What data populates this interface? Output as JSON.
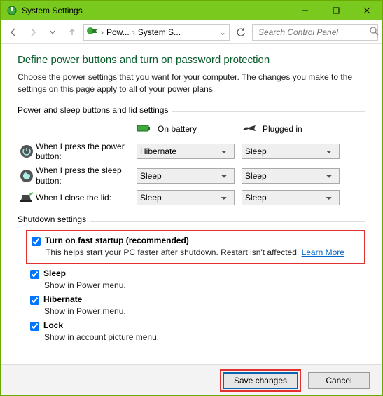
{
  "window": {
    "title": "System Settings"
  },
  "navbar": {
    "breadcrumb": {
      "item1": "Pow...",
      "item2": "System S..."
    },
    "search_placeholder": "Search Control Panel"
  },
  "page": {
    "title": "Define power buttons and turn on password protection",
    "description": "Choose the power settings that you want for your computer. The changes you make to the settings on this page apply to all of your power plans."
  },
  "buttons_section": {
    "label": "Power and sleep buttons and lid settings",
    "col_battery": "On battery",
    "col_plugged": "Plugged in",
    "rows": {
      "power_button": {
        "label": "When I press the power button:",
        "battery": "Hibernate",
        "plugged": "Sleep"
      },
      "sleep_button": {
        "label": "When I press the sleep button:",
        "battery": "Sleep",
        "plugged": "Sleep"
      },
      "lid": {
        "label": "When I close the lid:",
        "battery": "Sleep",
        "plugged": "Sleep"
      }
    }
  },
  "shutdown_section": {
    "label": "Shutdown settings",
    "fast_startup": {
      "label": "Turn on fast startup (recommended)",
      "desc": "This helps start your PC faster after shutdown. Restart isn't affected. ",
      "link": "Learn More"
    },
    "sleep": {
      "label": "Sleep",
      "desc": "Show in Power menu."
    },
    "hibernate": {
      "label": "Hibernate",
      "desc": "Show in Power menu."
    },
    "lock": {
      "label": "Lock",
      "desc": "Show in account picture menu."
    }
  },
  "footer": {
    "save": "Save changes",
    "cancel": "Cancel"
  }
}
